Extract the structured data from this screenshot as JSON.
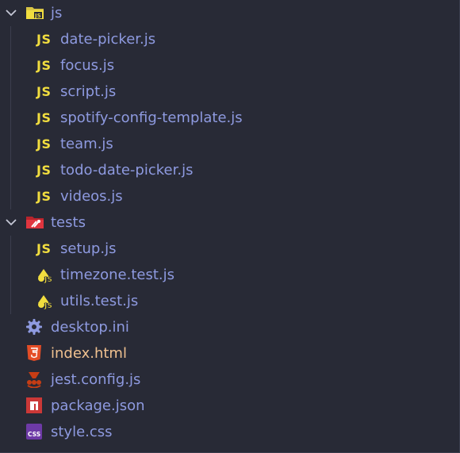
{
  "explorer": {
    "folders": {
      "js": {
        "name": "js",
        "files": [
          "date-picker.js",
          "focus.js",
          "script.js",
          "spotify-config-template.js",
          "team.js",
          "todo-date-picker.js",
          "videos.js"
        ]
      },
      "tests": {
        "name": "tests",
        "files": [
          "setup.js",
          "timezone.test.js",
          "utils.test.js"
        ]
      }
    },
    "root_files": [
      "desktop.ini",
      "index.html",
      "jest.config.js",
      "package.json",
      "style.css"
    ],
    "badges": {
      "js": "JS"
    },
    "icons": {
      "js_folder": "folder-js-icon",
      "tests_folder": "folder-test-icon",
      "js_file": "js-file-icon",
      "test_file": "jest-test-icon",
      "ini_file": "settings-gear-icon",
      "html_file": "html5-icon",
      "jest_config": "jest-icon",
      "package_json": "npm-icon",
      "css_file": "css-icon"
    },
    "colors": {
      "background": "#282a36",
      "label": "#8e9ae0",
      "html_label": "#f0c190",
      "js_badge": "#f1dd3f"
    }
  }
}
